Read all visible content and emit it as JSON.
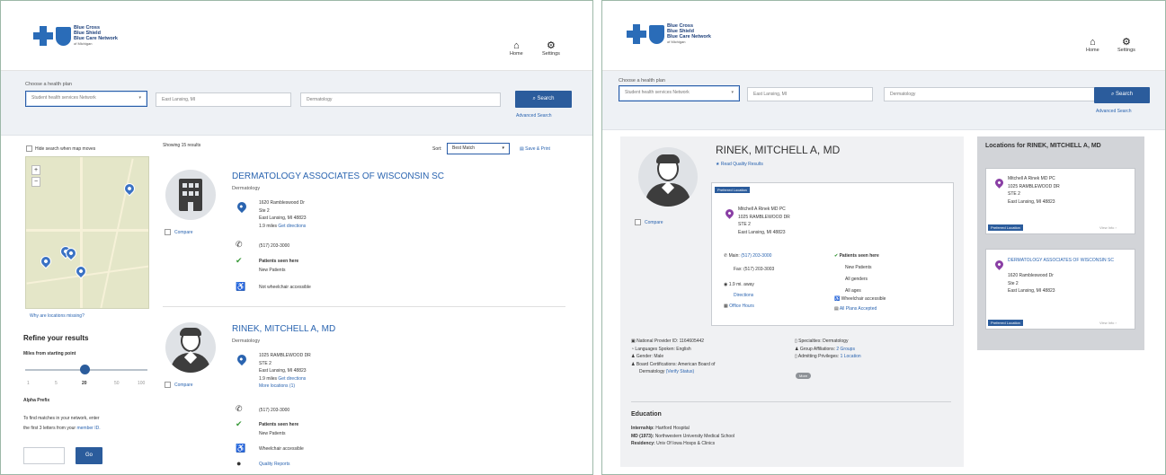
{
  "brand": {
    "name_lines": [
      "Blue Cross",
      "Blue Shield",
      "Blue Care Network"
    ],
    "sub": "of Michigan",
    "color": "#2a6cb8"
  },
  "nav": {
    "home": "Home",
    "settings": "Settings"
  },
  "left_screen": {
    "search": {
      "plan_label": "Choose a health plan",
      "plan_value": "Student health services Network",
      "location_value": "East Lansing, MI",
      "specialty_value": "Dermatology",
      "search_button": "Search",
      "advanced_link": "Advanced Search"
    },
    "sidebar": {
      "map_checkbox": "Hide search when map moves",
      "map_link": "Why are locations missing?",
      "refine_title": "Refine your results",
      "miles_label": "Miles from starting point",
      "miles_ticks": [
        "1",
        "5",
        "20",
        "50",
        "100"
      ],
      "miles_selected": "20",
      "alpha_title": "Alpha Prefix",
      "alpha_text_1": "To find matches in your network, enter",
      "alpha_text_2": "the first 3 letters from your",
      "alpha_link": "member ID.",
      "go_button": "Go"
    },
    "results": {
      "count_text": "Showing 15 results",
      "sort_label": "Sort:",
      "sort_value": "Best Match",
      "save_print": "Save & Print",
      "providers": [
        {
          "name": "DERMATOLOGY ASSOCIATES OF WISCONSIN SC",
          "specialty": "Dermatology",
          "compare": "Compare",
          "address": [
            "1620 Rambleswood Dr",
            "Ste 2",
            "East Lansing, MI 48823"
          ],
          "distance": "1.9 miles",
          "directions": "Get directions",
          "phone": "(517) 203-3000",
          "patients_title": "Patients seen here",
          "patients_value": "New Patients",
          "wheelchair": "Not wheelchair accessible"
        },
        {
          "name": "RINEK, MITCHELL A, MD",
          "specialty": "Dermatology",
          "compare": "Compare",
          "address": [
            "1025 RAMBLEWOOD DR",
            "STE 2",
            "East Lansing, MI 48823"
          ],
          "distance": "1.9 miles",
          "directions": "Get directions",
          "more_locations": "More locations (1)",
          "phone": "(517) 203-3000",
          "patients_title": "Patients seen here",
          "patients_value": "New Patients",
          "wheelchair": "Wheelchair accessible",
          "quality": "Quality Reports"
        }
      ]
    }
  },
  "right_screen": {
    "search": {
      "plan_label": "Choose a health plan",
      "plan_value": "Student health services Network",
      "location_value": "East Lansing, MI",
      "specialty_value": "Dermatology",
      "search_button": "Search",
      "advanced_link": "Advanced Search"
    },
    "provider": {
      "name": "RINEK, MITCHELL A, MD",
      "quality_link": "Read Quality Results",
      "compare": "Compare",
      "badge": "Preferred Location",
      "address": [
        "Mitchell A Rinek MD PC",
        "1025 RAMBLEWOOD DR",
        "STE 2",
        "East Lansing, MI 48823"
      ],
      "main_phone_label": "Main:",
      "main_phone": "(517) 203-3000",
      "fax": "Fax: (517) 203-3003",
      "distance": "1.9 mi. away",
      "directions": "Directions",
      "office_hours": "Office Hours",
      "patients_title": "Patients seen here",
      "patients_values": [
        "New Patients",
        "All genders",
        "All ages"
      ],
      "wheelchair": "Wheelchair accessible",
      "plans_link": "All Plans Accepted"
    },
    "details_left": [
      "National Provider ID: 1164605442",
      "Languages Spoken: English",
      "Gender: Male",
      "Board Certifications: American Board of",
      "Dermatology"
    ],
    "verify_link": "(Verify Status)",
    "details_right": [
      {
        "text": "Specialties: Dermatology"
      },
      {
        "text": "Group Affiliations:",
        "link": "2 Groups"
      },
      {
        "text": "Admitting Privileges:",
        "link": "1 Location"
      }
    ],
    "details_pill": "More",
    "education": {
      "title": "Education",
      "rows": [
        {
          "label": "Internship:",
          "value": "Hartford Hospital"
        },
        {
          "label": "MD (1973):",
          "value": "Northwestern University Medical School"
        },
        {
          "label": "Residency:",
          "value": "Univ Of Iowa Hosps & Clinics"
        }
      ]
    },
    "locations": {
      "title": "Locations for RINEK, MITCHELL A, MD",
      "cards": [
        {
          "lines": [
            "Mitchell A Rinek MD PC",
            "1025 RAMBLEWOOD DR",
            "STE 2",
            "East Lansing, MI 48823"
          ],
          "badge": "Preferred Location",
          "more": "View Info ›"
        },
        {
          "name_link": "DERMATOLOGY ASSOCIATES OF WISCONSIN SC",
          "lines": [
            "1620 Rambleswood Dr",
            "Ste 2",
            "East Lansing, MI 48823"
          ],
          "badge": "Preferred Location",
          "more": "View Info ›"
        }
      ]
    }
  },
  "colors": {
    "primary": "#2b5c9c",
    "link": "#2a64b0",
    "pin_purple": "#8a3fa5",
    "check_green": "#3a9a3a"
  }
}
